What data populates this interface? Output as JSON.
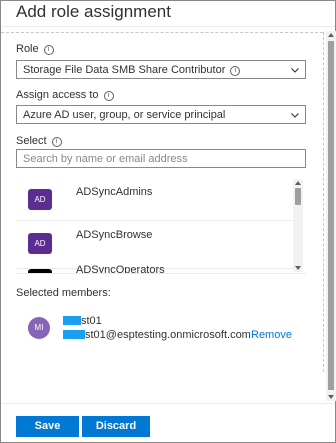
{
  "header": {
    "title": "Add role assignment"
  },
  "role": {
    "label": "Role",
    "value": "Storage File Data SMB Share Contributor"
  },
  "assign": {
    "label": "Assign access to",
    "value": "Azure AD user, group, or service principal"
  },
  "select": {
    "label": "Select",
    "placeholder": "Search by name or email address"
  },
  "list": {
    "items": [
      {
        "initials": "AD",
        "label": "ADSyncAdmins"
      },
      {
        "initials": "AD",
        "label": "ADSyncBrowse"
      },
      {
        "initials": "AD",
        "label": "ADSyncOperators"
      }
    ]
  },
  "members": {
    "label": "Selected members:",
    "items": [
      {
        "initials": "MI",
        "name_visible": "st01",
        "email_visible": "st01@esptesting.onmicrosoft.com",
        "remove_label": "Remove"
      }
    ]
  },
  "footer": {
    "save_label": "Save",
    "discard_label": "Discard"
  },
  "colors": {
    "primary": "#0078d4",
    "group_avatar": "#5c2d91",
    "member_avatar": "#8764b8",
    "redaction": "#1a9ff2"
  }
}
